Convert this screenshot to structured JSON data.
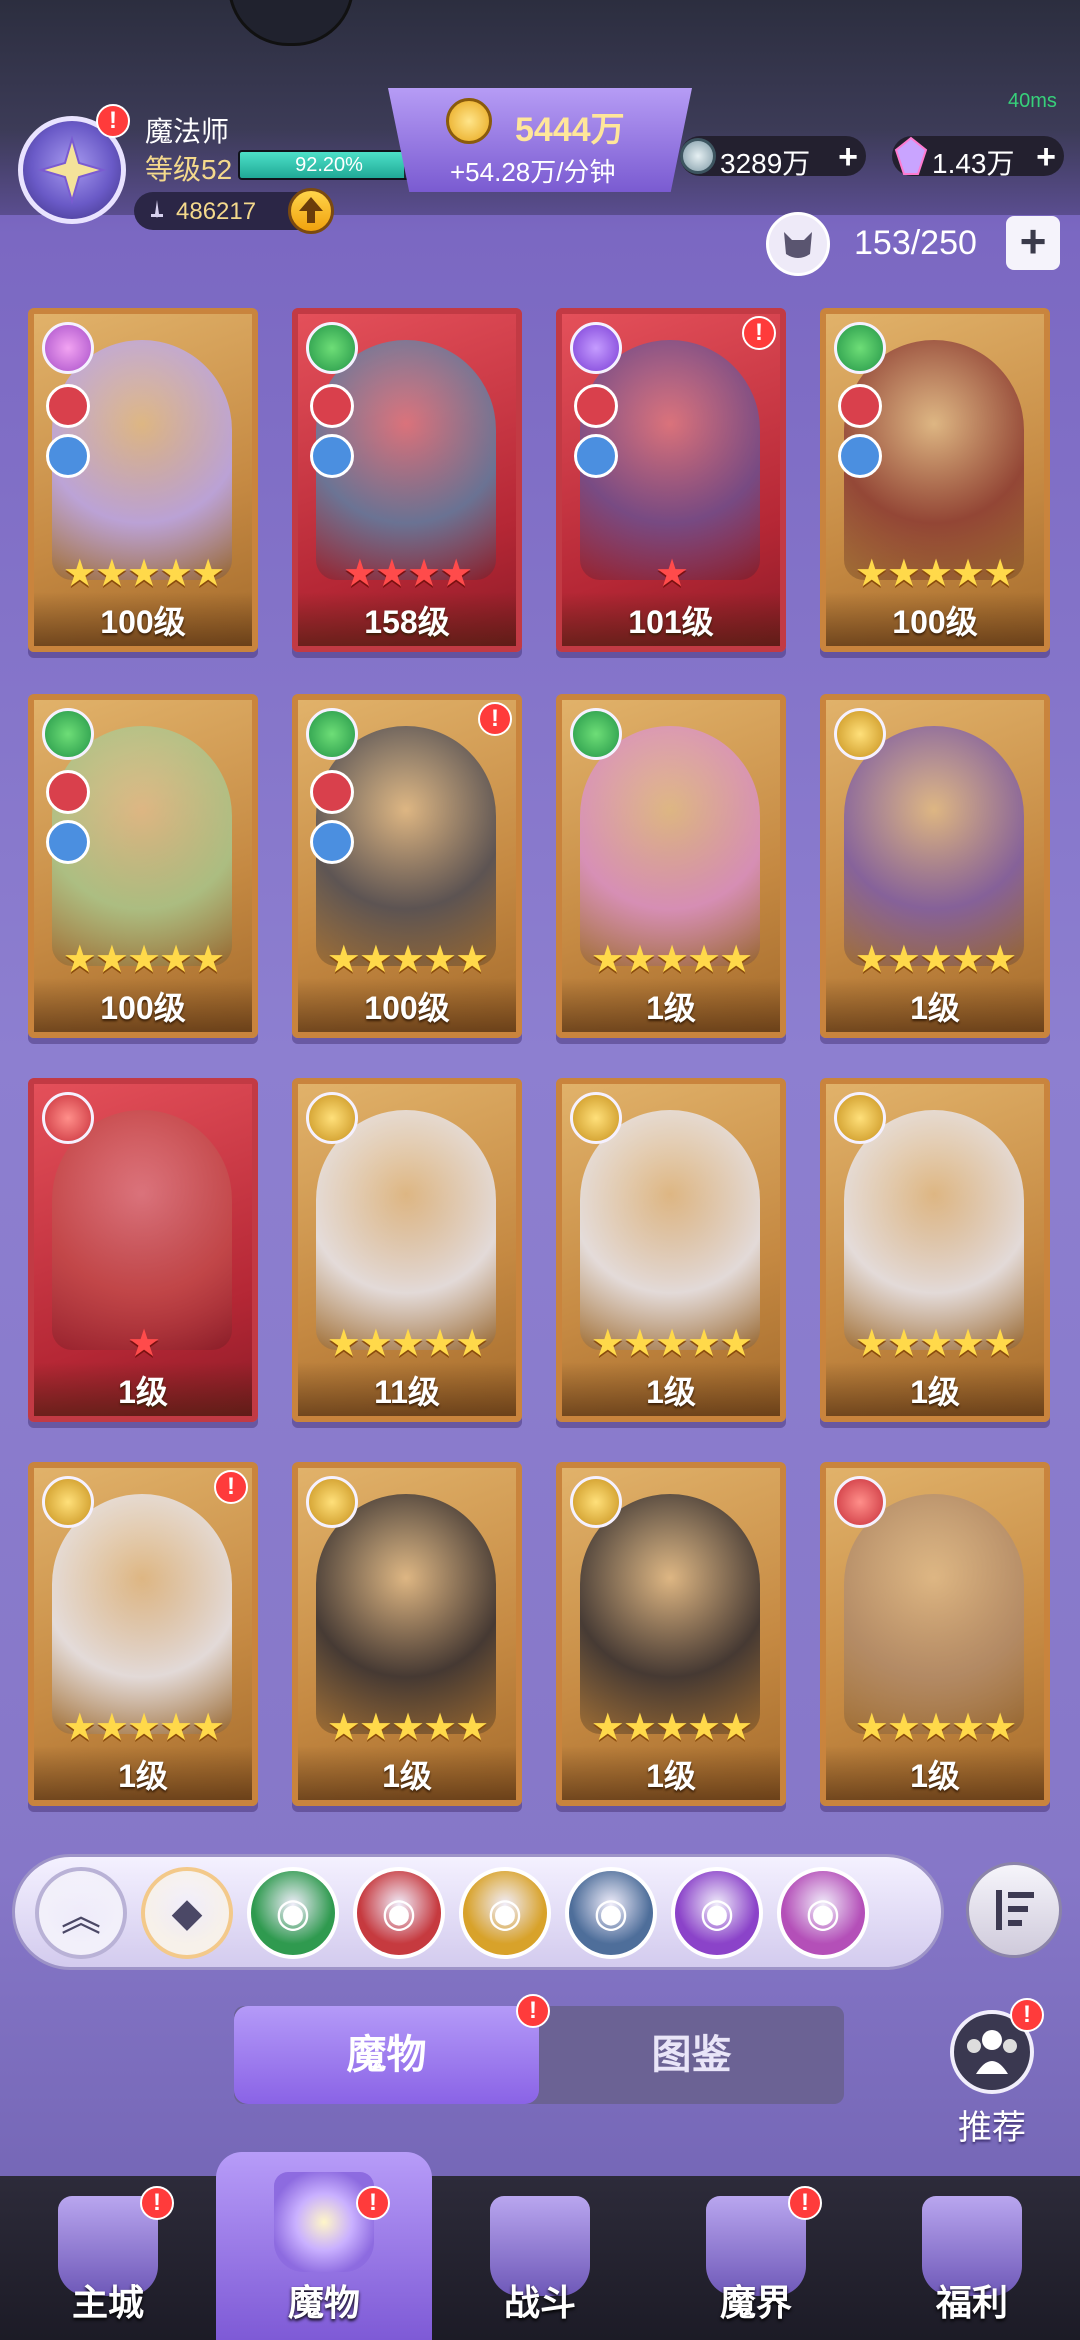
{
  "status": {
    "ping": "40ms"
  },
  "profile": {
    "name": "魔法师",
    "level_label": "等级52",
    "xp_percent_label": "92.20%",
    "xp_fraction": 0.922,
    "power": "486217"
  },
  "gold": {
    "amount": "5444万",
    "rate": "+54.28万/分钟"
  },
  "resources": [
    {
      "icon": "silver-coin-icon",
      "value": "3289万",
      "plus": "+"
    },
    {
      "icon": "crystal-icon",
      "value": "1.43万",
      "plus": "+"
    }
  ],
  "capacity": {
    "text": "153/250",
    "add": "+"
  },
  "cards": [
    {
      "name": "card-1",
      "level": "100级",
      "stars": 5,
      "star_color": "yellow",
      "faction": "pink",
      "roles": true,
      "frame": "gold",
      "art": "#b9a6ef",
      "badge": false
    },
    {
      "name": "card-2",
      "level": "158级",
      "stars": 4,
      "star_color": "red",
      "faction": "green",
      "roles": true,
      "frame": "red",
      "art": "#5c7fa3",
      "badge": false
    },
    {
      "name": "card-3",
      "level": "101级",
      "stars": 1,
      "star_color": "red",
      "faction": "purple",
      "roles": true,
      "frame": "red",
      "art": "#6b4f8f",
      "badge": true
    },
    {
      "name": "card-4",
      "level": "100级",
      "stars": 5,
      "star_color": "yellow",
      "faction": "green",
      "roles": true,
      "frame": "gold",
      "art": "#8a3a33",
      "badge": false
    },
    {
      "name": "card-5",
      "level": "100级",
      "stars": 5,
      "star_color": "yellow",
      "faction": "green",
      "roles": true,
      "frame": "gold",
      "art": "#a7c68c",
      "badge": false
    },
    {
      "name": "card-6",
      "level": "100级",
      "stars": 5,
      "star_color": "yellow",
      "faction": "green",
      "roles": true,
      "frame": "gold",
      "art": "#4a4a55",
      "badge": true
    },
    {
      "name": "card-7",
      "level": "1级",
      "stars": 5,
      "star_color": "yellow",
      "faction": "green",
      "roles": false,
      "frame": "gold",
      "art": "#d98fc8",
      "badge": false
    },
    {
      "name": "card-8",
      "level": "1级",
      "stars": 5,
      "star_color": "yellow",
      "faction": "gold",
      "roles": false,
      "frame": "gold",
      "art": "#7a5aa8",
      "badge": false
    },
    {
      "name": "card-9",
      "level": "1级",
      "stars": 1,
      "star_color": "red",
      "faction": "red",
      "roles": false,
      "frame": "red",
      "art": "#c24a4a",
      "badge": false
    },
    {
      "name": "card-10",
      "level": "11级",
      "stars": 5,
      "star_color": "yellow",
      "faction": "gold",
      "roles": false,
      "frame": "gold",
      "art": "#e8e8f2",
      "badge": false
    },
    {
      "name": "card-11",
      "level": "1级",
      "stars": 5,
      "star_color": "yellow",
      "faction": "gold",
      "roles": false,
      "frame": "gold",
      "art": "#e8e8f2",
      "badge": false
    },
    {
      "name": "card-12",
      "level": "1级",
      "stars": 5,
      "star_color": "yellow",
      "faction": "gold",
      "roles": false,
      "frame": "gold",
      "art": "#e8e8f2",
      "badge": false
    },
    {
      "name": "card-13",
      "level": "1级",
      "stars": 5,
      "star_color": "yellow",
      "faction": "gold",
      "roles": false,
      "frame": "gold",
      "art": "#e8e8f2",
      "badge": true
    },
    {
      "name": "card-14",
      "level": "1级",
      "stars": 5,
      "star_color": "yellow",
      "faction": "gold",
      "roles": false,
      "frame": "gold",
      "art": "#2f2b30",
      "badge": false
    },
    {
      "name": "card-15",
      "level": "1级",
      "stars": 5,
      "star_color": "yellow",
      "faction": "gold",
      "roles": false,
      "frame": "gold",
      "art": "#2f2b30",
      "badge": false
    },
    {
      "name": "card-16",
      "level": "1级",
      "stars": 5,
      "star_color": "yellow",
      "faction": "red",
      "roles": false,
      "frame": "gold",
      "art": "#b08a6a",
      "badge": false
    }
  ],
  "filters": [
    {
      "name": "collapse-filter-button",
      "icon": "chevron-up-icon",
      "bg": "#f2f0fa"
    },
    {
      "name": "filter-all-button",
      "icon": "diamond-grid-icon",
      "bg": "#f7f1ea"
    },
    {
      "name": "filter-nature-button",
      "icon": "leaf-icon",
      "bg": "#2f9a4f"
    },
    {
      "name": "filter-demon-button",
      "icon": "demon-mask-icon",
      "bg": "#c63a3f"
    },
    {
      "name": "filter-time-button",
      "icon": "hourglass-icon",
      "bg": "#d8a22a"
    },
    {
      "name": "filter-dragon-button",
      "icon": "dragon-icon",
      "bg": "#4e6e9a"
    },
    {
      "name": "filter-eye-button",
      "icon": "eye-icon",
      "bg": "#8b43c9"
    },
    {
      "name": "filter-arcane-button",
      "icon": "arcane-star-icon",
      "bg": "#b44fb8"
    }
  ],
  "tabs": {
    "monsters": "魔物",
    "codex": "图鉴"
  },
  "recommend": {
    "label": "推荐"
  },
  "nav": [
    {
      "label": "主城",
      "icon": "castle-icon",
      "badge": true
    },
    {
      "label": "魔物",
      "icon": "flame-star-icon",
      "badge": true,
      "active": true
    },
    {
      "label": "战斗",
      "icon": "shield-sword-icon",
      "badge": false
    },
    {
      "label": "魔界",
      "icon": "portal-icon",
      "badge": true
    },
    {
      "label": "福利",
      "icon": "treasure-chest-icon",
      "badge": false
    }
  ]
}
